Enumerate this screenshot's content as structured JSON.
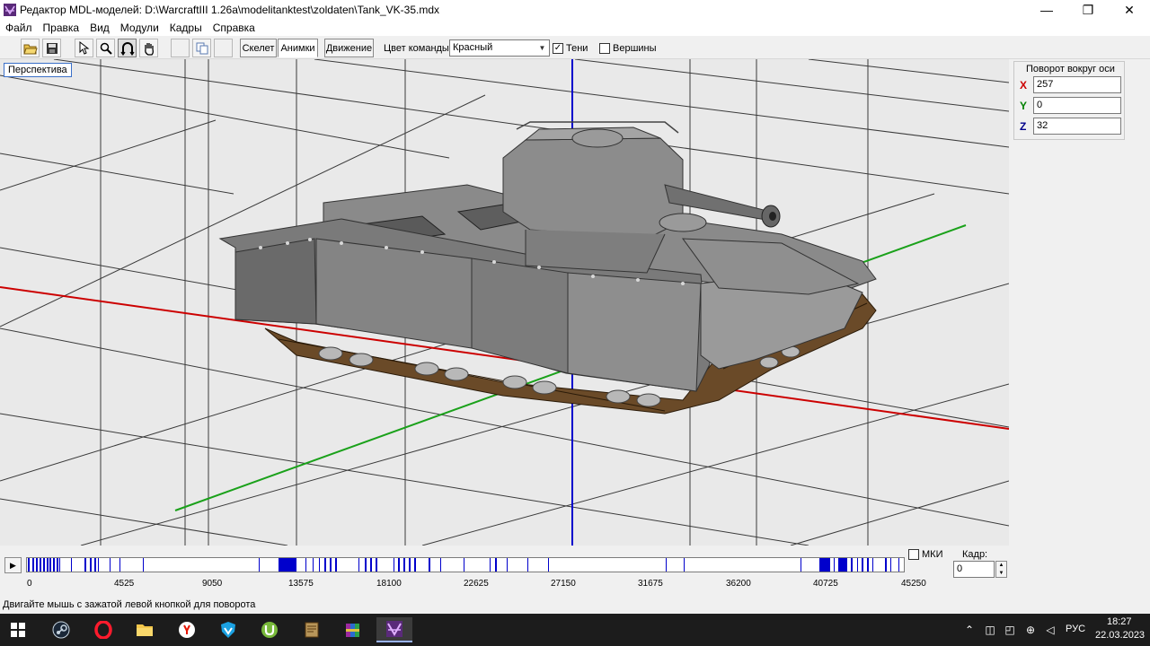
{
  "window": {
    "title": "Редактор MDL-моделей: D:\\WarcraftIII 1.26a\\modelitanktest\\zoldaten\\Tank_VK-35.mdx",
    "minimize": "—",
    "maximize": "❐",
    "close": "✕"
  },
  "menu": [
    "Файл",
    "Правка",
    "Вид",
    "Модули",
    "Кадры",
    "Справка"
  ],
  "toolbar": {
    "tabs": {
      "skeleton": "Скелет",
      "animations": "Анимки",
      "movement": "Движение"
    },
    "team_color_label": "Цвет команды:",
    "team_color_value": "Красный",
    "shadows_label": "Тени",
    "shadows_checked": true,
    "vertices_label": "Вершины",
    "vertices_checked": false
  },
  "viewport": {
    "projection_button": "Перспектива"
  },
  "rotation_panel": {
    "title": "Поворот вокруг оси",
    "x_label": "X",
    "x_value": "257",
    "y_label": "Y",
    "y_value": "0",
    "z_label": "Z",
    "z_value": "32",
    "colors": {
      "x": "#cc0000",
      "y": "#008000",
      "z": "#00008b"
    }
  },
  "timeline": {
    "ticks": [
      "0",
      "4525",
      "9050",
      "13575",
      "18100",
      "22625",
      "27150",
      "31675",
      "36200",
      "40725",
      "45250"
    ],
    "mki_label": "МКИ",
    "mki_checked": false,
    "frame_label": "Кадр:",
    "frame_value": "0",
    "marker_color": "#0000cc"
  },
  "status": {
    "text": "Двигайте мышь с зажатой левой кнопкой для поворота"
  },
  "taskbar": {
    "language": "РУС",
    "time": "18:27",
    "date": "22.03.2023"
  },
  "colors": {
    "axis_x": "#cc0000",
    "axis_y": "#1aa11a",
    "axis_z": "#0000cc",
    "grid": "#3a3a3a",
    "viewport_bg": "#e9e9e9"
  }
}
